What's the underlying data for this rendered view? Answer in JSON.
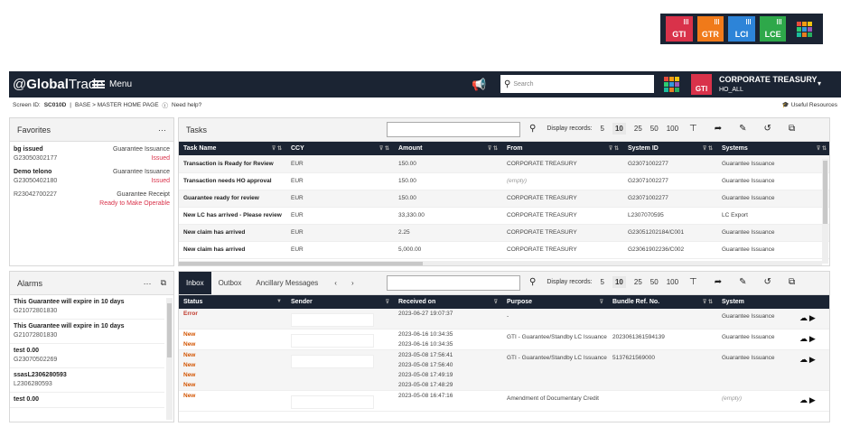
{
  "modules": [
    {
      "label": "GTI",
      "color": "#d9324a"
    },
    {
      "label": "GTR",
      "color": "#f07a1a"
    },
    {
      "label": "LCI",
      "color": "#2d84d8"
    },
    {
      "label": "LCE",
      "color": "#2ea84a"
    }
  ],
  "header": {
    "logo_prefix": "@",
    "logo_bold": "Global",
    "logo_rest": "Trade",
    "menu": "Menu",
    "search_placeholder": "Search",
    "module": "GTI",
    "org_title": "CORPORATE TREASURY",
    "org_sub": "HO_ALL"
  },
  "screenbar": {
    "screen_label": "Screen ID:",
    "screen_id": "SC010D",
    "path": "BASE > MASTER HOME PAGE",
    "help": "Need help?",
    "useful": "Useful Resources"
  },
  "favorites": {
    "title": "Favorites",
    "more": "···",
    "items": [
      {
        "title": "bg issued",
        "sub": "G23050302177",
        "type": "Guarantee Issuance",
        "status": "Issued"
      },
      {
        "title": "Demo telono",
        "sub": "G23050402180",
        "type": "Guarantee Issuance",
        "status": "Issued"
      },
      {
        "title": "",
        "sub": "R23042700227",
        "type": "Guarantee Receipt",
        "status": "Ready to Make Operable"
      }
    ]
  },
  "alarms": {
    "title": "Alarms",
    "more": "···",
    "items": [
      {
        "title": "This Guarantee will expire in 10 days",
        "sub": "G21072801830"
      },
      {
        "title": "This Guarantee will expire in 10 days",
        "sub": "G21072801830"
      },
      {
        "title": "test 0.00",
        "sub": "G23070502269"
      },
      {
        "title": "ssasL2306280593",
        "sub": "L2306280593"
      },
      {
        "title": "test 0.00",
        "sub": ""
      }
    ]
  },
  "tasks": {
    "title": "Tasks",
    "display_label": "Display records:",
    "sizes": [
      "5",
      "10",
      "25",
      "50",
      "100"
    ],
    "active_size": "10",
    "columns": [
      "Task Name",
      "CCY",
      "Amount",
      "From",
      "System ID",
      "Systems"
    ],
    "rows": [
      [
        "Transaction is Ready for Review",
        "EUR",
        "150.00",
        "CORPORATE TREASURY",
        "G23071002277",
        "Guarantee Issuance"
      ],
      [
        "Transaction needs HO approval",
        "EUR",
        "150.00",
        "(empty)",
        "G23071002277",
        "Guarantee Issuance"
      ],
      [
        "Guarantee ready for review",
        "EUR",
        "150.00",
        "CORPORATE TREASURY",
        "G23071002277",
        "Guarantee Issuance"
      ],
      [
        "New LC has arrived - Please review",
        "EUR",
        "33,330.00",
        "CORPORATE TREASURY",
        "L2307070595",
        "LC Export"
      ],
      [
        "New claim has arrived",
        "EUR",
        "2.25",
        "CORPORATE TREASURY",
        "G23051202184/C001",
        "Guarantee Issuance"
      ],
      [
        "New claim has arrived",
        "EUR",
        "5,000.00",
        "CORPORATE TREASURY",
        "G23061902236/C002",
        "Guarantee Issuance"
      ]
    ]
  },
  "inbox": {
    "tabs": [
      "Inbox",
      "Outbox",
      "Ancillary Messages"
    ],
    "display_label": "Display records:",
    "sizes": [
      "5",
      "10",
      "25",
      "50",
      "100"
    ],
    "active_size": "10",
    "columns": [
      "Status",
      "Sender",
      "Received on",
      "Purpose",
      "Bundle Ref. No.",
      "System"
    ],
    "rows": [
      {
        "status": [
          "Error"
        ],
        "received": [
          "2023-06-27 19:07:37"
        ],
        "purpose": "-",
        "bundle": "",
        "system": "Guarantee Issuance"
      },
      {
        "status": [
          "New",
          "New"
        ],
        "received": [
          "2023-06-16 10:34:35",
          "2023-06-16 10:34:35"
        ],
        "purpose": "GTI - Guarantee/Standby LC Issuance",
        "bundle": "2023061361594139",
        "system": "Guarantee Issuance"
      },
      {
        "status": [
          "New",
          "New",
          "New",
          "New"
        ],
        "received": [
          "2023-05-08 17:56:41",
          "2023-05-08 17:56:40",
          "2023-05-08 17:49:19",
          "2023-05-08 17:48:29"
        ],
        "purpose": "GTI - Guarantee/Standby LC Issuance",
        "bundle": "5137621569000",
        "system": "Guarantee Issuance"
      },
      {
        "status": [
          "New"
        ],
        "received": [
          "2023-05-08 16:47:16"
        ],
        "purpose": "Amendment of Documentary Credit",
        "bundle": "",
        "system": "(empty)"
      }
    ]
  }
}
